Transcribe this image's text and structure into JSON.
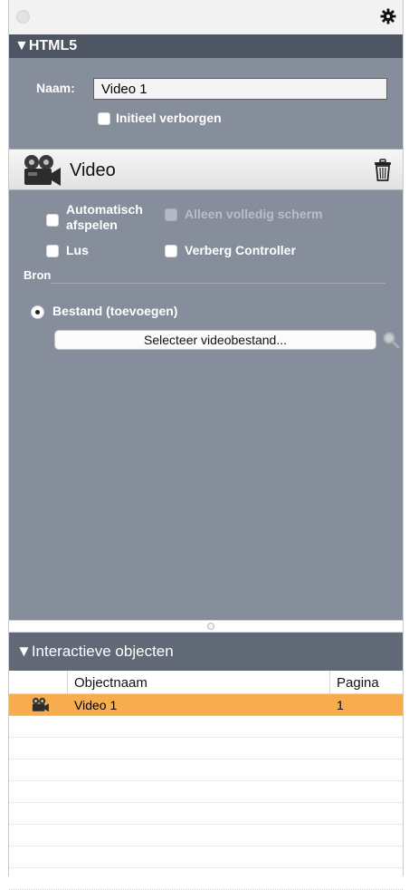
{
  "html5_section": {
    "title": "HTML5",
    "name_label": "Naam:",
    "name_value": "Video 1",
    "hidden_label": "Initieel verborgen"
  },
  "video": {
    "title": "Video",
    "autoplay_line1": "Automatisch",
    "autoplay_line2": "afspelen",
    "fullscreen_only": "Alleen volledig scherm",
    "loop": "Lus",
    "hide_controller": "Verberg Controller",
    "source_label": "Bron",
    "file_option": "Bestand (toevoegen)",
    "select_button": "Selecteer videobestand..."
  },
  "interactive_objects": {
    "title": "Interactieve objecten",
    "columns": [
      "Objectnaam",
      "Pagina"
    ],
    "rows": [
      {
        "name": "Video 1",
        "page": "1",
        "selected": true
      }
    ]
  },
  "colors": {
    "header_dark": "#4d5462",
    "panel_gray": "#878e9b",
    "selection": "#f7ad4d"
  }
}
